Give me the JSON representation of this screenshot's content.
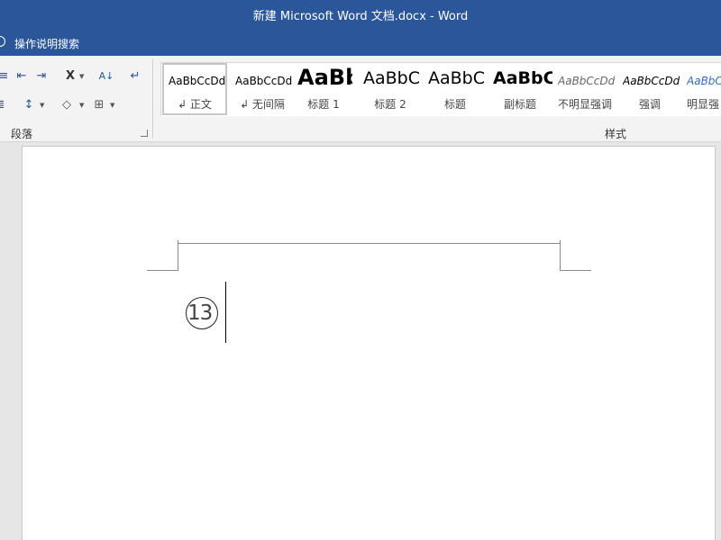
{
  "window": {
    "title": "新建 Microsoft Word 文档.docx  -  Word"
  },
  "tell_me": {
    "label": "操作说明搜索",
    "icon": "lightbulb-icon"
  },
  "ribbon": {
    "paragraph_group": {
      "label": "段落",
      "icons": [
        "decrease-indent-icon",
        "increase-indent-icon",
        "chinese-layout-icon",
        "sort-icon",
        "show-marks-icon",
        "align-icon",
        "line-spacing-icon",
        "shading-icon",
        "borders-icon"
      ]
    },
    "styles_group": {
      "label": "样式",
      "items": [
        {
          "preview": "AaBbCcDd",
          "name": "↲ 正文",
          "selected": true
        },
        {
          "preview": "AaBbCcDd",
          "name": "↲ 无间隔"
        },
        {
          "preview": "AaBb",
          "name": "标题 1"
        },
        {
          "preview": "AaBbC",
          "name": "标题 2"
        },
        {
          "preview": "AaBbC",
          "name": "标题"
        },
        {
          "preview": "AaBbC",
          "name": "副标题"
        },
        {
          "preview": "AaBbCcDd",
          "name": "不明显强调"
        },
        {
          "preview": "AaBbCcDd",
          "name": "强调"
        },
        {
          "preview": "AaBbCcDd",
          "name": "明显强"
        }
      ]
    }
  },
  "document": {
    "enclosed_character": "13"
  }
}
